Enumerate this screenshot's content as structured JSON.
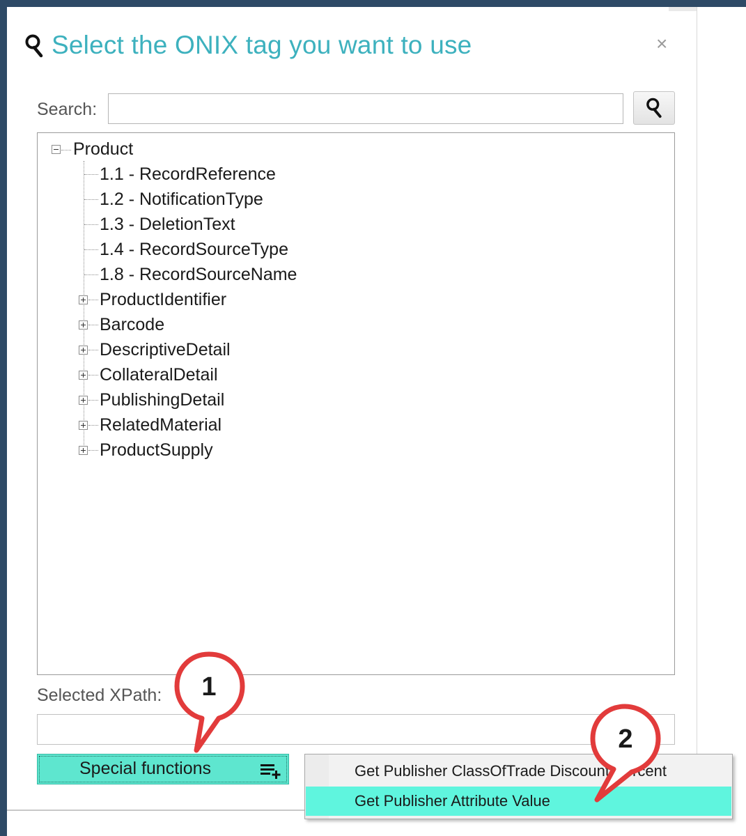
{
  "dialog": {
    "title": "Select the ONIX tag you want to use",
    "close_glyph": "×"
  },
  "search": {
    "label": "Search:",
    "value": "",
    "button_icon": "search-icon"
  },
  "tree": {
    "root": {
      "label": "Product",
      "expanded": true
    },
    "leaves": [
      "1.1 - RecordReference",
      "1.2 - NotificationType",
      "1.3 - DeletionText",
      "1.4 - RecordSourceType",
      "1.8 - RecordSourceName"
    ],
    "groups": [
      "ProductIdentifier",
      "Barcode",
      "DescriptiveDetail",
      "CollateralDetail",
      "PublishingDetail",
      "RelatedMaterial",
      "ProductSupply"
    ]
  },
  "xpath": {
    "label": "Selected XPath:",
    "value": ""
  },
  "special_functions": {
    "label": "Special functions",
    "icon": "add-list-icon"
  },
  "context_menu": {
    "items": [
      {
        "label": "Get Publisher ClassOfTrade Discount Percent",
        "highlighted": false
      },
      {
        "label": "Get Publisher Attribute Value",
        "highlighted": true
      }
    ]
  },
  "callouts": [
    {
      "number": "1"
    },
    {
      "number": "2"
    }
  ],
  "colors": {
    "title": "#3db1be",
    "accent": "#5ee6cf",
    "menu_highlight": "#5ff5de",
    "callout_red": "#e23b3b",
    "window_border": "#2e4a66"
  }
}
